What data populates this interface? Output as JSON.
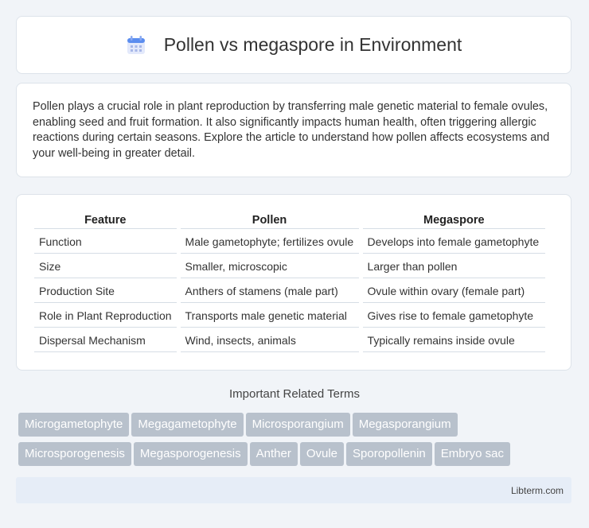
{
  "header": {
    "title": "Pollen vs megaspore in Environment",
    "icon": "calendar-icon"
  },
  "intro": {
    "text": "Pollen plays a crucial role in plant reproduction by transferring male genetic material to female ovules, enabling seed and fruit formation. It also significantly impacts human health, often triggering allergic reactions during certain seasons. Explore the article to understand how pollen affects ecosystems and your well-being in greater detail."
  },
  "table": {
    "headers": [
      "Feature",
      "Pollen",
      "Megaspore"
    ],
    "rows": [
      [
        "Function",
        "Male gametophyte; fertilizes ovule",
        "Develops into female gametophyte"
      ],
      [
        "Size",
        "Smaller, microscopic",
        "Larger than pollen"
      ],
      [
        "Production Site",
        "Anthers of stamens (male part)",
        "Ovule within ovary (female part)"
      ],
      [
        "Role in Plant Reproduction",
        "Transports male genetic material",
        "Gives rise to female gametophyte"
      ],
      [
        "Dispersal Mechanism",
        "Wind, insects, animals",
        "Typically remains inside ovule"
      ]
    ]
  },
  "terms": {
    "title": "Important Related Terms",
    "items": [
      "Microgametophyte",
      "Megagametophyte",
      "Microsporangium",
      "Megasporangium",
      "Microsporogenesis",
      "Megasporogenesis",
      "Anther",
      "Ovule",
      "Sporopollenin",
      "Embryo sac"
    ]
  },
  "footer": {
    "text": "Libterm.com"
  },
  "colors": {
    "tag_bg": "#b8c1cc",
    "footer_bg": "#e6edf7",
    "icon_accent": "#5b8def"
  }
}
